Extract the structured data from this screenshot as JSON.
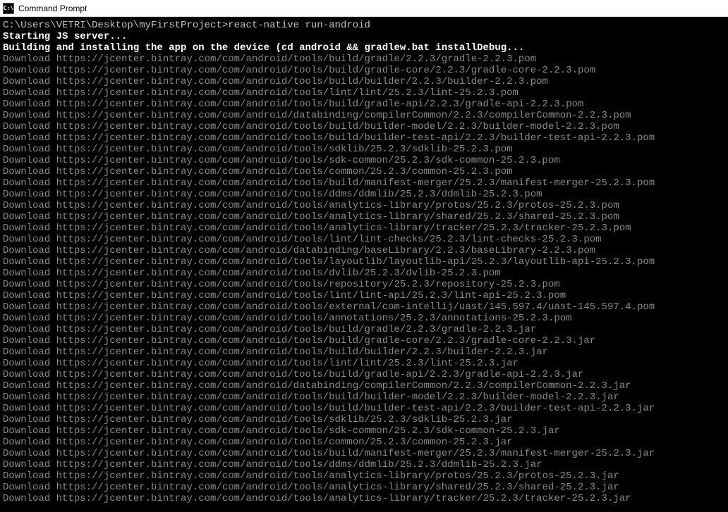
{
  "window": {
    "title": "Command Prompt",
    "icon_label": "C:\\"
  },
  "prompt": {
    "path": "C:\\Users\\VETRI\\Desktop\\myFirstProject>",
    "command": "react-native run-android"
  },
  "status_lines": [
    "Starting JS server...",
    "Building and installing the app on the device (cd android && gradlew.bat installDebug..."
  ],
  "downloads": [
    "https://jcenter.bintray.com/com/android/tools/build/gradle/2.2.3/gradle-2.2.3.pom",
    "https://jcenter.bintray.com/com/android/tools/build/gradle-core/2.2.3/gradle-core-2.2.3.pom",
    "https://jcenter.bintray.com/com/android/tools/build/builder/2.2.3/builder-2.2.3.pom",
    "https://jcenter.bintray.com/com/android/tools/lint/lint/25.2.3/lint-25.2.3.pom",
    "https://jcenter.bintray.com/com/android/tools/build/gradle-api/2.2.3/gradle-api-2.2.3.pom",
    "https://jcenter.bintray.com/com/android/databinding/compilerCommon/2.2.3/compilerCommon-2.2.3.pom",
    "https://jcenter.bintray.com/com/android/tools/build/builder-model/2.2.3/builder-model-2.2.3.pom",
    "https://jcenter.bintray.com/com/android/tools/build/builder-test-api/2.2.3/builder-test-api-2.2.3.pom",
    "https://jcenter.bintray.com/com/android/tools/sdklib/25.2.3/sdklib-25.2.3.pom",
    "https://jcenter.bintray.com/com/android/tools/sdk-common/25.2.3/sdk-common-25.2.3.pom",
    "https://jcenter.bintray.com/com/android/tools/common/25.2.3/common-25.2.3.pom",
    "https://jcenter.bintray.com/com/android/tools/build/manifest-merger/25.2.3/manifest-merger-25.2.3.pom",
    "https://jcenter.bintray.com/com/android/tools/ddms/ddmlib/25.2.3/ddmlib-25.2.3.pom",
    "https://jcenter.bintray.com/com/android/tools/analytics-library/protos/25.2.3/protos-25.2.3.pom",
    "https://jcenter.bintray.com/com/android/tools/analytics-library/shared/25.2.3/shared-25.2.3.pom",
    "https://jcenter.bintray.com/com/android/tools/analytics-library/tracker/25.2.3/tracker-25.2.3.pom",
    "https://jcenter.bintray.com/com/android/tools/lint/lint-checks/25.2.3/lint-checks-25.2.3.pom",
    "https://jcenter.bintray.com/com/android/databinding/baseLibrary/2.2.3/baseLibrary-2.2.3.pom",
    "https://jcenter.bintray.com/com/android/tools/layoutlib/layoutlib-api/25.2.3/layoutlib-api-25.2.3.pom",
    "https://jcenter.bintray.com/com/android/tools/dvlib/25.2.3/dvlib-25.2.3.pom",
    "https://jcenter.bintray.com/com/android/tools/repository/25.2.3/repository-25.2.3.pom",
    "https://jcenter.bintray.com/com/android/tools/lint/lint-api/25.2.3/lint-api-25.2.3.pom",
    "https://jcenter.bintray.com/com/android/tools/external/com-intellij/uast/145.597.4/uast-145.597.4.pom",
    "https://jcenter.bintray.com/com/android/tools/annotations/25.2.3/annotations-25.2.3.pom",
    "https://jcenter.bintray.com/com/android/tools/build/gradle/2.2.3/gradle-2.2.3.jar",
    "https://jcenter.bintray.com/com/android/tools/build/gradle-core/2.2.3/gradle-core-2.2.3.jar",
    "https://jcenter.bintray.com/com/android/tools/build/builder/2.2.3/builder-2.2.3.jar",
    "https://jcenter.bintray.com/com/android/tools/lint/lint/25.2.3/lint-25.2.3.jar",
    "https://jcenter.bintray.com/com/android/tools/build/gradle-api/2.2.3/gradle-api-2.2.3.jar",
    "https://jcenter.bintray.com/com/android/databinding/compilerCommon/2.2.3/compilerCommon-2.2.3.jar",
    "https://jcenter.bintray.com/com/android/tools/build/builder-model/2.2.3/builder-model-2.2.3.jar",
    "https://jcenter.bintray.com/com/android/tools/build/builder-test-api/2.2.3/builder-test-api-2.2.3.jar",
    "https://jcenter.bintray.com/com/android/tools/sdklib/25.2.3/sdklib-25.2.3.jar",
    "https://jcenter.bintray.com/com/android/tools/sdk-common/25.2.3/sdk-common-25.2.3.jar",
    "https://jcenter.bintray.com/com/android/tools/common/25.2.3/common-25.2.3.jar",
    "https://jcenter.bintray.com/com/android/tools/build/manifest-merger/25.2.3/manifest-merger-25.2.3.jar",
    "https://jcenter.bintray.com/com/android/tools/ddms/ddmlib/25.2.3/ddmlib-25.2.3.jar",
    "https://jcenter.bintray.com/com/android/tools/analytics-library/protos/25.2.3/protos-25.2.3.jar",
    "https://jcenter.bintray.com/com/android/tools/analytics-library/shared/25.2.3/shared-25.2.3.jar",
    "https://jcenter.bintray.com/com/android/tools/analytics-library/tracker/25.2.3/tracker-25.2.3.jar"
  ],
  "download_prefix": "Download "
}
